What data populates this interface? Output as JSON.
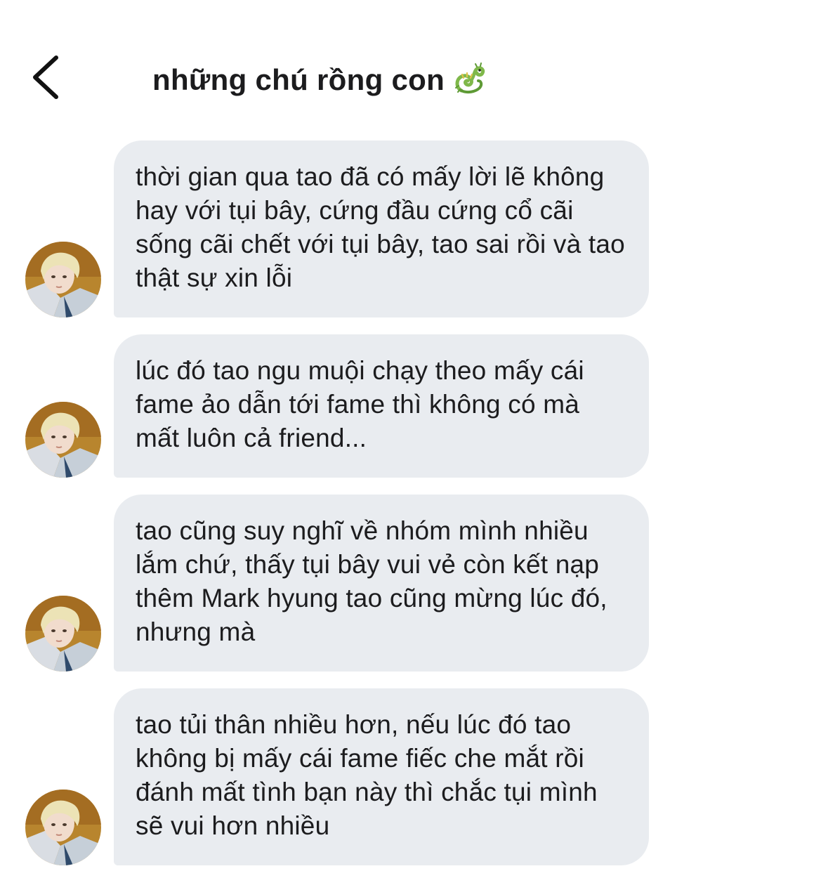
{
  "header": {
    "back_icon": "chevron-left-icon",
    "title": "những chú rồng con",
    "title_emoji": "dragon-icon"
  },
  "messages": [
    {
      "text": "thời gian qua tao đã có mấy lời lẽ không hay với tụi bây, cứng đầu cứng cổ cãi sống cãi chết với tụi bây, tao sai rồi và tao thật sự xin lỗi"
    },
    {
      "text": "lúc đó tao ngu muội chạy theo mấy cái fame ảo dẫn tới fame thì không có mà mất luôn cả friend..."
    },
    {
      "text": "tao cũng suy nghĩ về nhóm mình nhiều lắm chứ, thấy tụi bây vui vẻ còn kết nạp thêm Mark hyung tao cũng mừng lúc đó, nhưng mà"
    },
    {
      "text": "tao tủi thân nhiều hơn, nếu lúc đó tao không bị mấy cái fame fiếc che mắt rồi đánh mất tình bạn này thì chắc tụi mình sẽ vui hơn nhiều"
    }
  ],
  "colors": {
    "bubble": "#e9ecf0",
    "text": "#1c1c1e",
    "background": "#ffffff"
  }
}
